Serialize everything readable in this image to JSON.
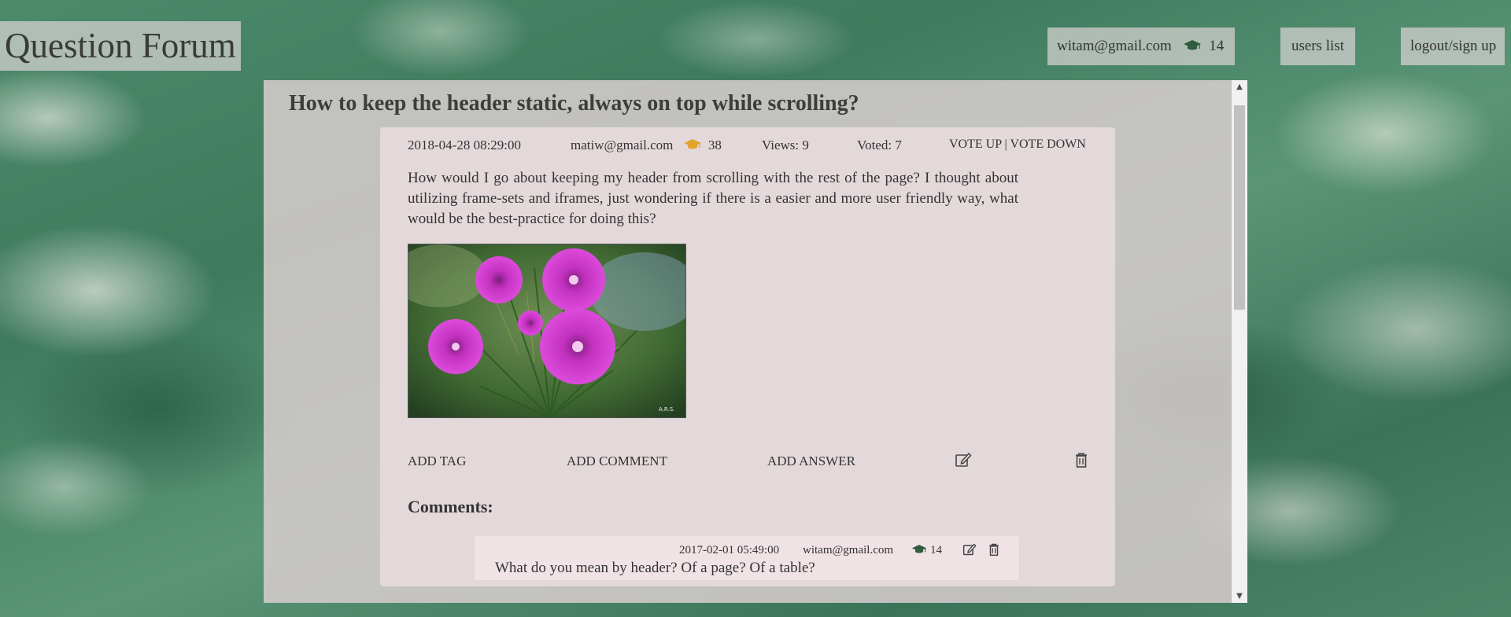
{
  "header": {
    "site_title": "Question Forum",
    "user_email": "witam@gmail.com",
    "user_reputation": "14",
    "users_list_label": "users list",
    "logout_label": "logout/sign up"
  },
  "question": {
    "title": "How to keep the header static, always on top while scrolling?",
    "date": "2018-04-28 08:29:00",
    "author": "matiw@gmail.com",
    "author_reputation": "38",
    "views": "Views: 9",
    "voted": "Voted: 7",
    "vote_up_label": "VOTE UP",
    "vote_separator": "|",
    "vote_down_label": "VOTE DOWN",
    "body": "How would I go about keeping my header from scrolling with the rest of the page? I thought about utilizing frame-sets and iframes, just wondering if there is a easier and more user friendly way, what would be the best-practice for doing this?",
    "image_watermark": "A.R.S.",
    "actions": {
      "add_tag": "ADD TAG",
      "add_comment": "ADD COMMENT",
      "add_answer": "ADD ANSWER"
    }
  },
  "comments": {
    "heading": "Comments:",
    "items": [
      {
        "date": "2017-02-01 05:49:00",
        "author": "witam@gmail.com",
        "reputation": "14",
        "text": "What do you mean by header? Of a page? Of a table?"
      }
    ]
  },
  "colors": {
    "grad_cap_green": "#2f5c3f",
    "grad_cap_gold": "#e2a42b",
    "flower_magenta": "#d63ad2"
  },
  "icons": {
    "reputation": "graduation-cap-icon",
    "edit": "edit-icon",
    "delete": "trash-icon"
  }
}
